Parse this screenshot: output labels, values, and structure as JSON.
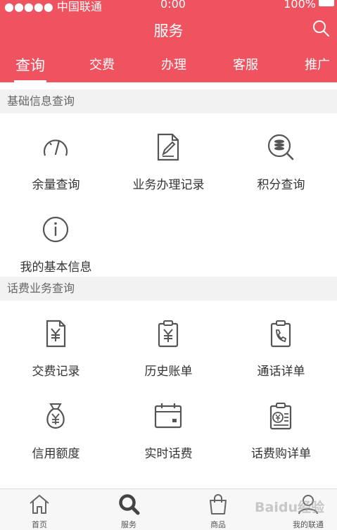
{
  "status_bar": {
    "carrier": "●●●●● 中国联通",
    "time": "0:00",
    "battery": "100%"
  },
  "header": {
    "title": "服务"
  },
  "tabs": [
    {
      "label": "查询",
      "active": true
    },
    {
      "label": "交费",
      "active": false
    },
    {
      "label": "办理",
      "active": false
    },
    {
      "label": "客服",
      "active": false
    },
    {
      "label": "推广",
      "active": false
    }
  ],
  "sections": [
    {
      "title": "基础信息查询",
      "items": [
        {
          "label": "余量查询",
          "icon": "gauge-icon"
        },
        {
          "label": "业务办理记录",
          "icon": "document-edit-icon"
        },
        {
          "label": "积分查询",
          "icon": "coins-search-icon"
        },
        {
          "label": "我的基本信息",
          "icon": "info-icon"
        }
      ]
    },
    {
      "title": "话费业务查询",
      "items": [
        {
          "label": "交费记录",
          "icon": "yuan-document-icon"
        },
        {
          "label": "历史账单",
          "icon": "yuan-clipboard-icon"
        },
        {
          "label": "通话详单",
          "icon": "phone-clipboard-icon"
        },
        {
          "label": "信用额度",
          "icon": "money-bag-icon"
        },
        {
          "label": "实时话费",
          "icon": "calendar-icon"
        },
        {
          "label": "话费购详单",
          "icon": "yuan-list-icon"
        }
      ]
    }
  ],
  "bottom_nav": [
    {
      "label": "首页",
      "icon": "home-icon"
    },
    {
      "label": "服务",
      "icon": "search-icon",
      "active": true
    },
    {
      "label": "商品",
      "icon": "shopping-bag-icon"
    },
    {
      "label": "我的联通",
      "icon": "user-icon"
    }
  ],
  "watermark": "Baidu经验",
  "colors": {
    "brand": "#ef5360",
    "icon_stroke": "#555555",
    "section_bg": "#f2f2f2"
  }
}
